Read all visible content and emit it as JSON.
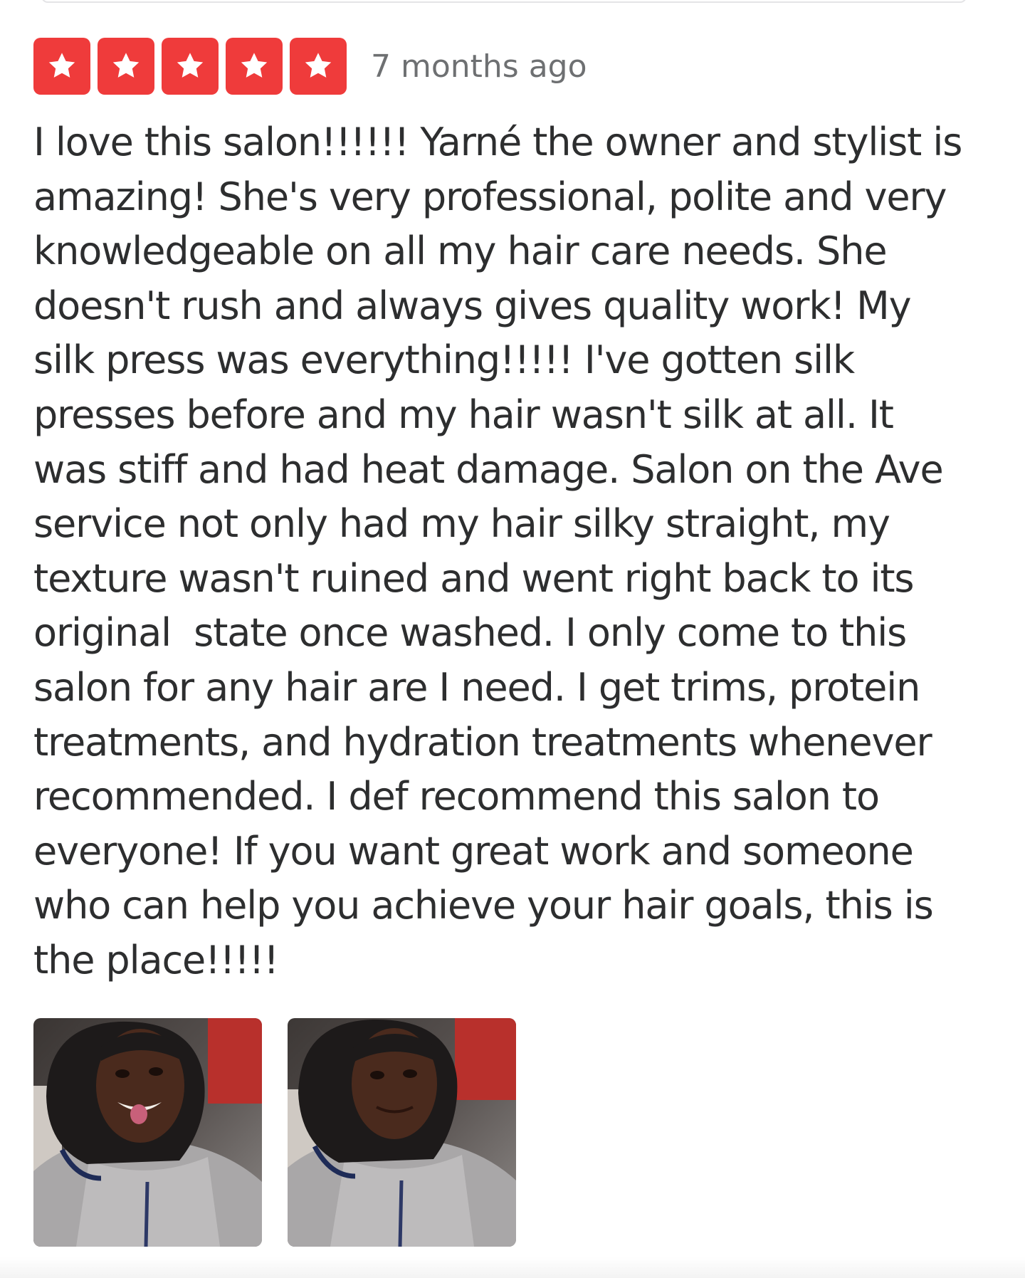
{
  "review": {
    "rating": 5,
    "rating_max": 5,
    "star_color": "#ef3b3b",
    "date": "7 months ago",
    "lines": [
      "I love this salon!!!!!! Yarné the owner and stylist is",
      "amazing! She's very professional, polite and very",
      "knowledgeable on all my hair care needs. She",
      "doesn't rush and always gives quality work! My",
      "silk press was everything!!!!! I've gotten silk",
      "presses before and my hair wasn't silk at all. It",
      "was stiff and had heat damage. Salon on the Ave",
      "service not only had my hair silky straight, my",
      "texture wasn't ruined and went right back to its",
      "original  state once washed. I only come to this",
      "salon for any hair are I need. I get trims, protein",
      "treatments, and hydration treatments whenever",
      "recommended. I def recommend this salon to",
      "everyone! If you want great work and someone",
      "who can help you achieve your hair goals, this is",
      "the place!!!!!"
    ]
  },
  "photos": [
    {
      "icon": "review-photo-1"
    },
    {
      "icon": "review-photo-2"
    }
  ]
}
